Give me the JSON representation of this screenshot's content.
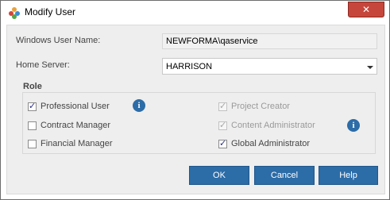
{
  "window": {
    "title": "Modify User",
    "close_icon": "close-icon",
    "app_icon": "users-icon"
  },
  "form": {
    "windows_user_name_label": "Windows User Name:",
    "windows_user_name_value": "NEWFORMA\\qaservice",
    "home_server_label": "Home Server:",
    "home_server_value": "HARRISON"
  },
  "role": {
    "title": "Role",
    "items": [
      {
        "label": "Professional User",
        "checked": true,
        "enabled": true,
        "info": true
      },
      {
        "label": "Contract Manager",
        "checked": false,
        "enabled": true,
        "info": false
      },
      {
        "label": "Financial Manager",
        "checked": false,
        "enabled": true,
        "info": false
      },
      {
        "label": "Project Creator",
        "checked": true,
        "enabled": false,
        "info": false
      },
      {
        "label": "Content Administrator",
        "checked": true,
        "enabled": false,
        "info": true
      },
      {
        "label": "Global Administrator",
        "checked": true,
        "enabled": true,
        "info": false
      }
    ]
  },
  "buttons": {
    "ok": "OK",
    "cancel": "Cancel",
    "help": "Help"
  },
  "colors": {
    "button": "#2c6ca7",
    "close": "#c7463b",
    "panel": "#eeeeee"
  }
}
